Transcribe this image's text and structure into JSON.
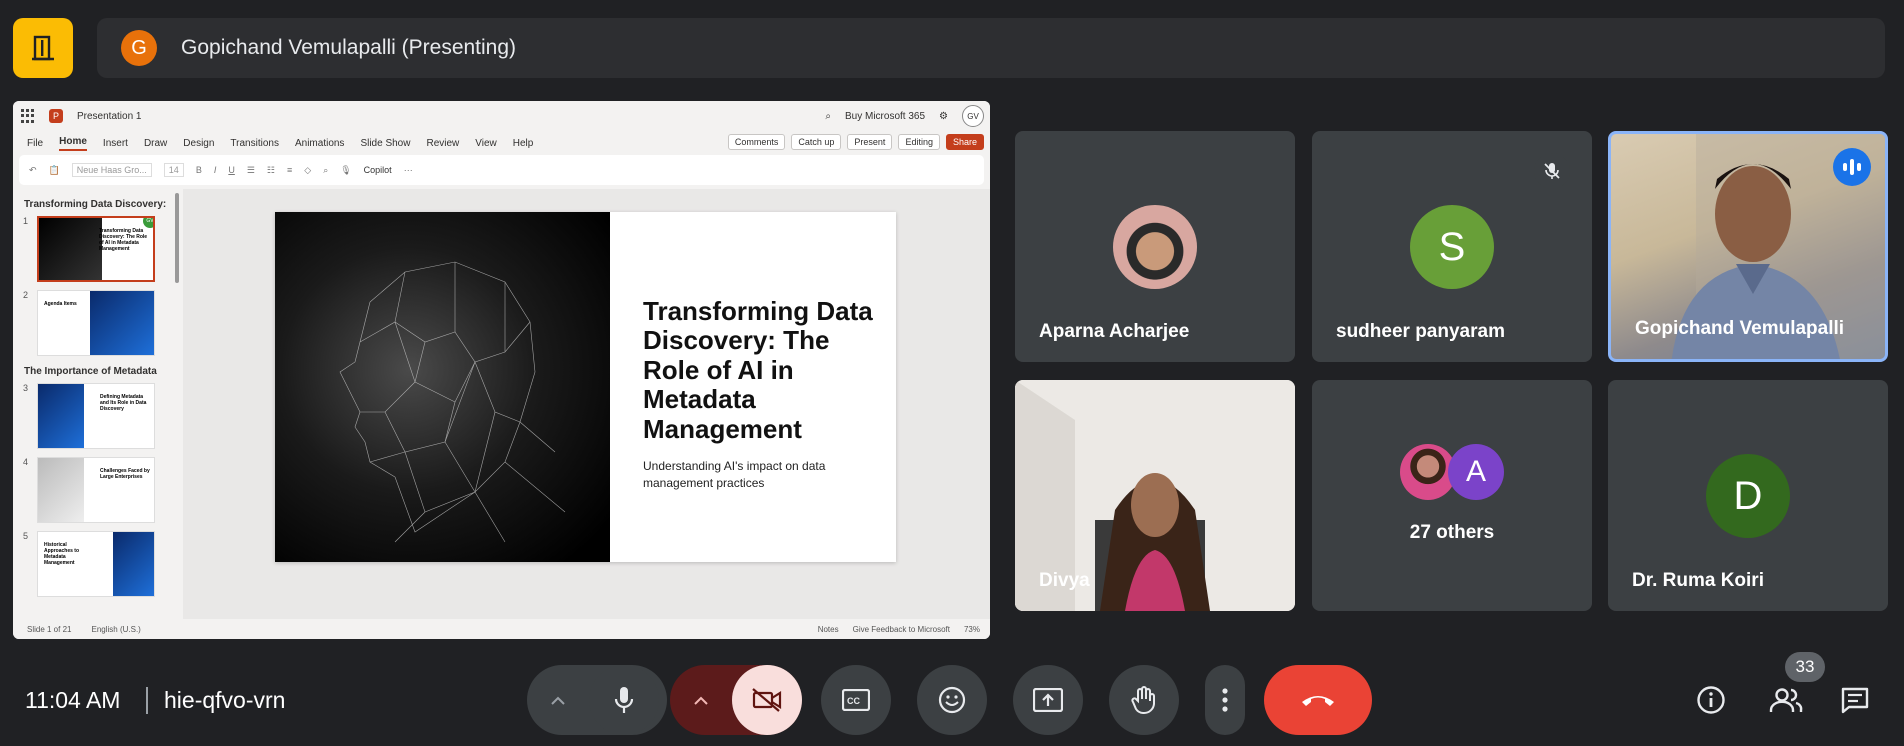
{
  "presenter": {
    "initial": "G",
    "label": "Gopichand Vemulapalli (Presenting)"
  },
  "ppt": {
    "file_name": "Presentation 1",
    "buy_label": "Buy Microsoft 365",
    "user_initials": "GV",
    "menu": [
      "File",
      "Home",
      "Insert",
      "Draw",
      "Design",
      "Transitions",
      "Animations",
      "Slide Show",
      "Review",
      "View",
      "Help"
    ],
    "comments_label": "Comments",
    "catchup_label": "Catch up",
    "present_label": "Present",
    "editing_label": "Editing",
    "share_label": "Share",
    "font_name": "Neue Haas Gro...",
    "font_size": "14",
    "copilot_label": "Copilot",
    "sections": [
      "Transforming Data Discovery:",
      "The Importance of Metadata"
    ],
    "thumbs": [
      {
        "num": "1",
        "text": "Transforming Data Discovery: The Role of AI in Metadata Management"
      },
      {
        "num": "2",
        "text": "Agenda Items"
      },
      {
        "num": "3",
        "text": "Defining Metadata and Its Role in Data Discovery"
      },
      {
        "num": "4",
        "text": "Challenges Faced by Large Enterprises"
      },
      {
        "num": "5",
        "text": "Historical Approaches to Metadata Management"
      }
    ],
    "slide_title": "Transforming Data Discovery: The Role of AI in Metadata Management",
    "slide_subtitle": "Understanding AI's impact on data management practices",
    "status_slide": "Slide 1 of 21",
    "status_lang": "English (U.S.)",
    "status_notes": "Notes",
    "status_feedback": "Give Feedback to Microsoft",
    "status_zoom": "73%"
  },
  "participants": [
    {
      "name": "Aparna Acharjee"
    },
    {
      "name": "sudheer panyaram",
      "initial": "S",
      "color": "#689f38"
    },
    {
      "name": "Gopichand Vemulapalli"
    },
    {
      "name": "Divya"
    },
    {
      "name": "27 others",
      "initial": "A",
      "color": "#7b43c9"
    },
    {
      "name": "Dr. Ruma Koiri",
      "initial": "D",
      "color": "#33691e"
    }
  ],
  "bottom": {
    "time": "11:04 AM",
    "meeting_code": "hie-qfvo-vrn",
    "participant_count": "33"
  }
}
